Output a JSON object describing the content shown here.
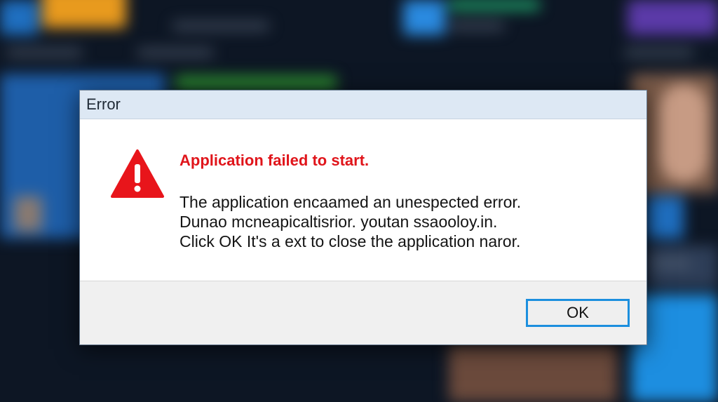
{
  "dialog": {
    "title": "Error",
    "icon": "warning-triangle-icon",
    "heading": "Application failed to start.",
    "message_lines": [
      "The application encaamed an unespected error.",
      "Dunao mcneapicaltisrior. youtan ssaooloy.in.",
      "Click OK  It's a ext to close the application naror."
    ],
    "ok_label": "OK"
  },
  "colors": {
    "heading": "#e0151b",
    "warning_icon": "#e8151b",
    "focus_border": "#1c8fde",
    "titlebar": "#dde8f4"
  }
}
